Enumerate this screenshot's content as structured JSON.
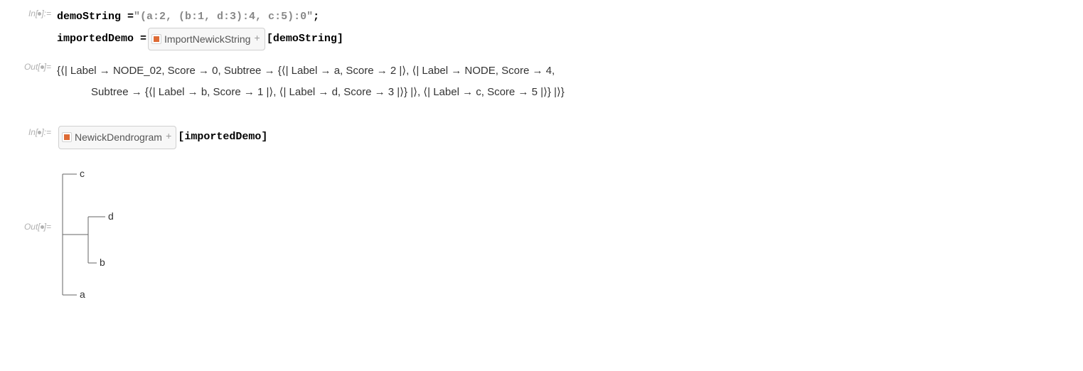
{
  "labels": {
    "in": "In[",
    "out": "Out[",
    "close_assign": "]:=",
    "close_eq": "]="
  },
  "input1": {
    "line1_lhs": "demoString = ",
    "line1_string": "\"(a:2, (b:1, d:3):4, c:5):0\"",
    "line1_semi": ";",
    "line2_lhs": "importedDemo = ",
    "line2_bracket_open": "[",
    "line2_arg": "demoString",
    "line2_bracket_close": "]"
  },
  "resource": {
    "name1": "ImportNewickString",
    "name2": "NewickDendrogram"
  },
  "output1": {
    "text_part1": "{⟨| Label → NODE_02, Score → 0, Subtree → {⟨| Label → a, Score → 2 |⟩, ⟨| Label → NODE, Score → 4,",
    "text_part2": "Subtree → {⟨| Label → b, Score → 1 |⟩, ⟨| Label → d, Score → 3 |⟩} |⟩, ⟨| Label → c, Score → 5 |⟩} |⟩}"
  },
  "input2": {
    "bracket_open": "[",
    "arg": "importedDemo",
    "bracket_close": "]"
  },
  "dendro": {
    "labels": {
      "a": "a",
      "b": "b",
      "c": "c",
      "d": "d"
    }
  }
}
